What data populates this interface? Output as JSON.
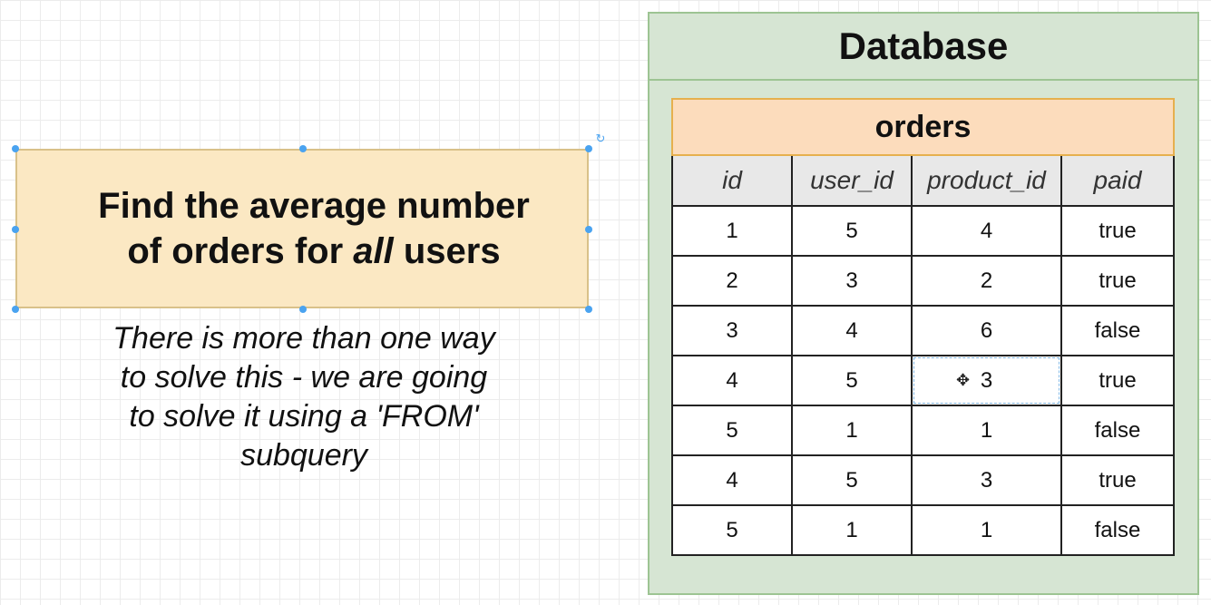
{
  "task": {
    "title_line1": "Find the average number",
    "title_line2_before": "of orders for ",
    "title_line2_em": "all",
    "title_line2_after": " users"
  },
  "note": {
    "line1": "There is more than one way",
    "line2": "to solve this - we are going",
    "line3": "to solve it using a 'FROM'",
    "line4": "subquery"
  },
  "database": {
    "title": "Database",
    "table": {
      "name": "orders",
      "columns": [
        "id",
        "user_id",
        "product_id",
        "paid"
      ],
      "rows": [
        [
          "1",
          "5",
          "4",
          "true"
        ],
        [
          "2",
          "3",
          "2",
          "true"
        ],
        [
          "3",
          "4",
          "6",
          "false"
        ],
        [
          "4",
          "5",
          "3",
          "true"
        ],
        [
          "5",
          "1",
          "1",
          "false"
        ],
        [
          "4",
          "5",
          "3",
          "true"
        ],
        [
          "5",
          "1",
          "1",
          "false"
        ]
      ]
    }
  },
  "icons": {
    "rotate": "rotate-icon",
    "move": "move-cursor-icon"
  },
  "colors": {
    "task_fill": "#fbe8c3",
    "db_fill": "#d6e5d3",
    "table_title_fill": "#fcdcbc",
    "selection": "#4aa3f0"
  }
}
